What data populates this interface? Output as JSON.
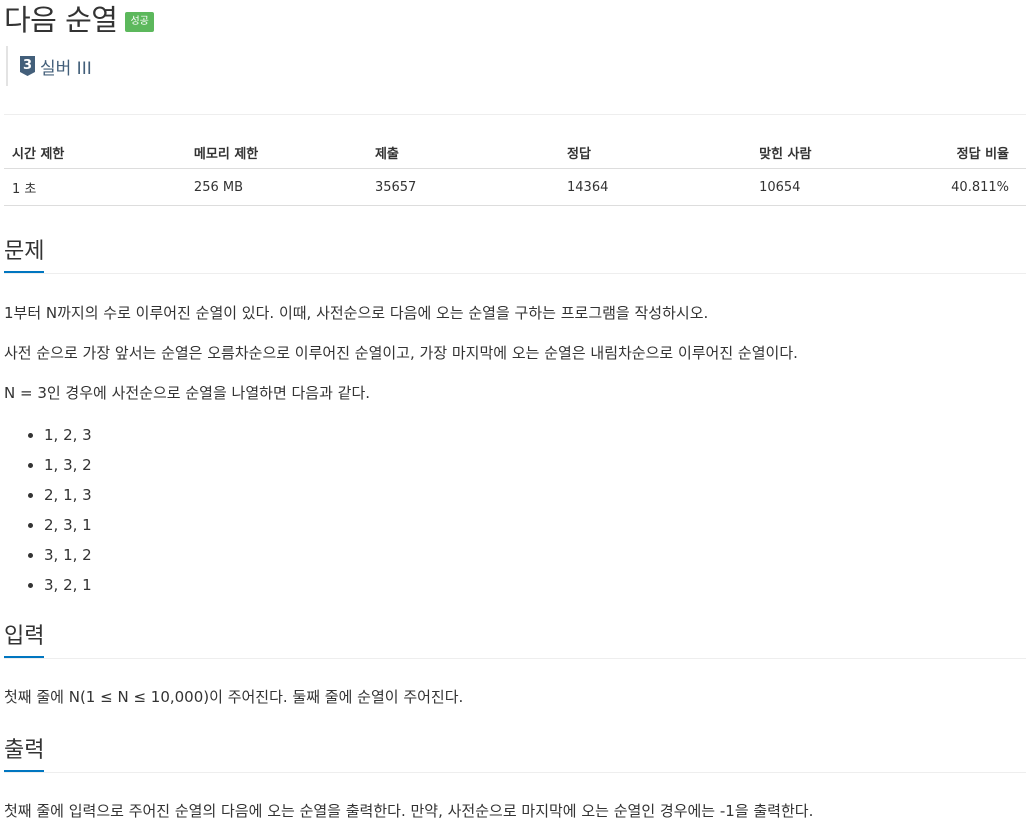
{
  "problem": {
    "title": "다음 순열",
    "badge": "성공",
    "tier_number": "3",
    "tier_label": "실버 III"
  },
  "info_table": {
    "headers": [
      "시간 제한",
      "메모리 제한",
      "제출",
      "정답",
      "맞힌 사람",
      "정답 비율"
    ],
    "values": [
      "1 초",
      "256 MB",
      "35657",
      "14364",
      "10654",
      "40.811%"
    ]
  },
  "sections": {
    "problem_heading": "문제",
    "problem_p1": "1부터 N까지의 수로 이루어진 순열이 있다. 이때, 사전순으로 다음에 오는 순열을 구하는 프로그램을 작성하시오.",
    "problem_p2": "사전 순으로 가장 앞서는 순열은 오름차순으로 이루어진 순열이고, 가장 마지막에 오는 순열은 내림차순으로 이루어진 순열이다.",
    "problem_p3": "N = 3인 경우에 사전순으로 순열을 나열하면 다음과 같다.",
    "permutations": [
      "1, 2, 3",
      "1, 3, 2",
      "2, 1, 3",
      "2, 3, 1",
      "3, 1, 2",
      "3, 2, 1"
    ],
    "input_heading": "입력",
    "input_text": "첫째 줄에 N(1 ≤ N ≤ 10,000)이 주어진다. 둘째 줄에 순열이 주어진다.",
    "output_heading": "출력",
    "output_text": "첫째 줄에 입력으로 주어진 순열의 다음에 오는 순열을 출력한다. 만약, 사전순으로 마지막에 오는 순열인 경우에는 -1을 출력한다."
  }
}
